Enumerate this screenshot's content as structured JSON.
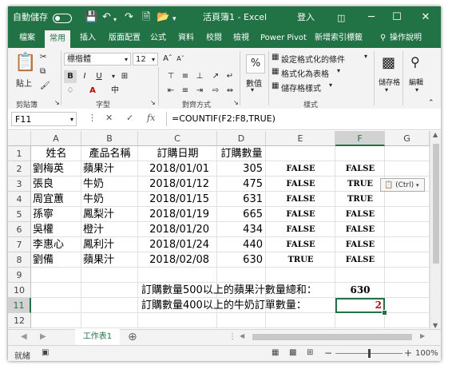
{
  "titlebar": {
    "autosave_label": "自動儲存",
    "autosave_state": "關閉",
    "doc_title": "活頁簿1 - Excel",
    "signin": "登入",
    "minimize_glyph": "─",
    "restore_glyph": "☐",
    "close_glyph": "✕"
  },
  "ribbon_tabs": [
    "檔案",
    "常用",
    "插入",
    "版面配置",
    "公式",
    "資料",
    "校閱",
    "檢視",
    "Power Pivot",
    "新增索引標籤"
  ],
  "tell_me": "操作說明",
  "ribbon": {
    "paste_label": "貼上",
    "clipboard_label": "剪貼簿",
    "font_name": "標楷體",
    "font_size": "12",
    "bold": "B",
    "italic": "I",
    "underline": "U",
    "font_group_label": "字型",
    "align_group_label": "對齊方式",
    "percent_glyph": "%",
    "number_label": "數值",
    "cond_format": "設定格式化的條件",
    "format_as_table": "格式化為表格",
    "cell_styles": "儲存格樣式",
    "styles_label": "樣式",
    "cells_label": "儲存格",
    "editing_label": "編輯"
  },
  "formula_bar": {
    "name_box": "F11",
    "fx": "fx",
    "formula": "=COUNTIF(F2:F8,TRUE)"
  },
  "columns": [
    "A",
    "B",
    "C",
    "D",
    "E",
    "F",
    "G"
  ],
  "rows": [
    "1",
    "2",
    "3",
    "4",
    "5",
    "6",
    "7",
    "8",
    "9",
    "10",
    "11",
    "12"
  ],
  "table": {
    "headers": [
      "姓名",
      "產品名稱",
      "訂購日期",
      "訂購數量"
    ],
    "records": [
      {
        "name": "劉梅英",
        "product": "蘋果汁",
        "date": "2018/01/01",
        "qty": "305",
        "e": "FALSE",
        "f": "FALSE"
      },
      {
        "name": "張良",
        "product": "牛奶",
        "date": "2018/01/12",
        "qty": "475",
        "e": "FALSE",
        "f": "TRUE"
      },
      {
        "name": "周宜蕙",
        "product": "牛奶",
        "date": "2018/01/15",
        "qty": "631",
        "e": "FALSE",
        "f": "TRUE"
      },
      {
        "name": "孫寧",
        "product": "鳳梨汁",
        "date": "2018/01/19",
        "qty": "665",
        "e": "FALSE",
        "f": "FALSE"
      },
      {
        "name": "吳權",
        "product": "橙汁",
        "date": "2018/01/20",
        "qty": "434",
        "e": "FALSE",
        "f": "FALSE"
      },
      {
        "name": "李惠心",
        "product": "鳳利汁",
        "date": "2018/01/24",
        "qty": "440",
        "e": "FALSE",
        "f": "FALSE"
      },
      {
        "name": "劉備",
        "product": "蘋果汁",
        "date": "2018/02/08",
        "qty": "630",
        "e": "TRUE",
        "f": "FALSE"
      }
    ]
  },
  "summary": {
    "row10_label": "訂購數量500以上的蘋果汁數量總和：",
    "row10_value": "630",
    "row11_label": "訂購數量400以上的牛奶訂單數量：",
    "row11_value": "2"
  },
  "paste_options": "(Ctrl)",
  "sheet_tab": "工作表1",
  "status": {
    "ready": "就緒",
    "zoom": "100%",
    "minus": "−",
    "plus": "+"
  },
  "colors": {
    "excel_green": "#217346",
    "result_red": "#c00000"
  }
}
